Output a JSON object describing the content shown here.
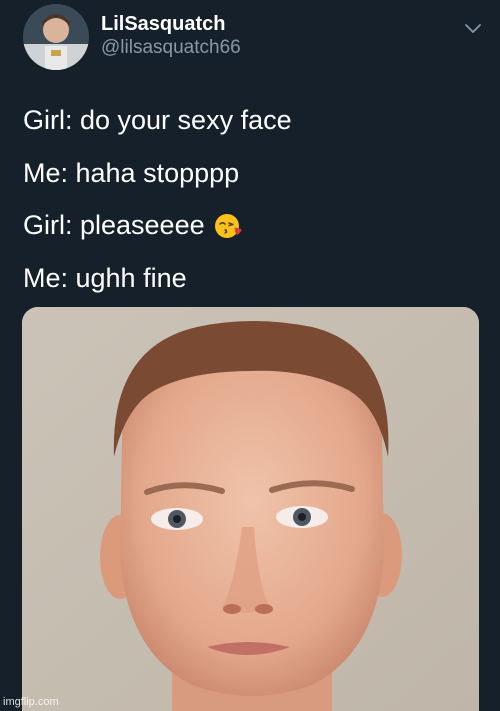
{
  "tweet": {
    "display_name": "LilSasquatch",
    "handle": "@lilsasquatch66",
    "lines": [
      "Girl: do your sexy face",
      "Me: haha stopppp",
      "Girl: pleaseeee",
      "Me: ughh fine"
    ],
    "emoji_icon": "face-blowing-kiss-icon"
  },
  "watermark": "imgflip.com",
  "colors": {
    "background": "#15202b",
    "text_primary": "#ffffff",
    "text_secondary": "#8899a6"
  }
}
